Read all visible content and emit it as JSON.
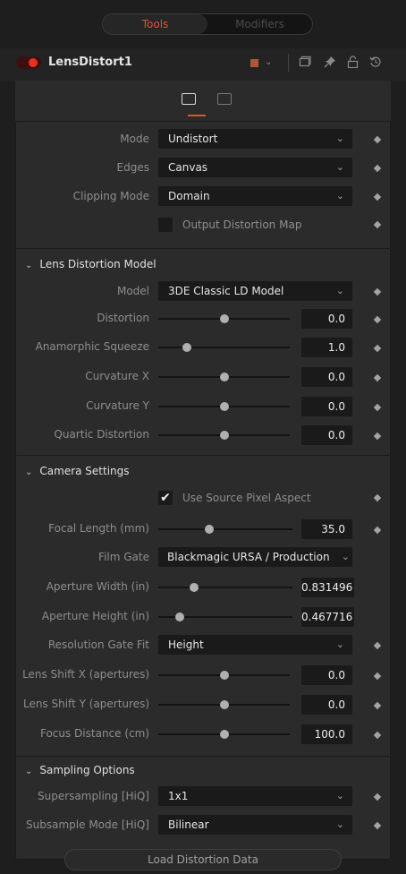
{
  "tabs": {
    "tools": "Tools",
    "modifiers": "Modifiers"
  },
  "tool": {
    "name": "LensDistort1"
  },
  "colors": {
    "accent": "#e0513a",
    "toggle": "#e8311e",
    "swatch": "#b3553a"
  },
  "icons": [
    "color-swatch-icon",
    "chevron-down-icon",
    "window-icon",
    "pin-icon",
    "lock-icon",
    "reset-icon",
    "tools-tab-icon",
    "settings-tab-icon"
  ],
  "general": {
    "mode": {
      "label": "Mode",
      "value": "Undistort"
    },
    "edges": {
      "label": "Edges",
      "value": "Canvas"
    },
    "clipping": {
      "label": "Clipping Mode",
      "value": "Domain"
    },
    "output_map": {
      "label": "Output Distortion Map",
      "checked": false
    }
  },
  "lens": {
    "title": "Lens Distortion Model",
    "model": {
      "label": "Model",
      "value": "3DE Classic LD Model"
    },
    "sliders": [
      {
        "label": "Distortion",
        "value": "0.0"
      },
      {
        "label": "Anamorphic Squeeze",
        "value": "1.0"
      },
      {
        "label": "Curvature X",
        "value": "0.0"
      },
      {
        "label": "Curvature Y",
        "value": "0.0"
      },
      {
        "label": "Quartic Distortion",
        "value": "0.0"
      }
    ]
  },
  "camera": {
    "title": "Camera Settings",
    "use_source": {
      "label": "Use Source Pixel Aspect",
      "checked": true
    },
    "focal": {
      "label": "Focal Length (mm)",
      "value": "35.0"
    },
    "film_gate": {
      "label": "Film Gate",
      "value": "Blackmagic URSA / Production"
    },
    "ap_width": {
      "label": "Aperture Width (in)",
      "value": "0.831496"
    },
    "ap_height": {
      "label": "Aperture Height (in)",
      "value": "0.467716"
    },
    "res_gate": {
      "label": "Resolution Gate Fit",
      "value": "Height"
    },
    "shift_x": {
      "label": "Lens Shift X (apertures)",
      "value": "0.0"
    },
    "shift_y": {
      "label": "Lens Shift Y (apertures)",
      "value": "0.0"
    },
    "focus": {
      "label": "Focus Distance (cm)",
      "value": "100.0"
    }
  },
  "sampling": {
    "title": "Sampling Options",
    "supersampling": {
      "label": "Supersampling [HiQ]",
      "value": "1x1"
    },
    "subsample": {
      "label": "Subsample Mode [HiQ]",
      "value": "Bilinear"
    }
  },
  "load_button": "Load Distortion Data"
}
